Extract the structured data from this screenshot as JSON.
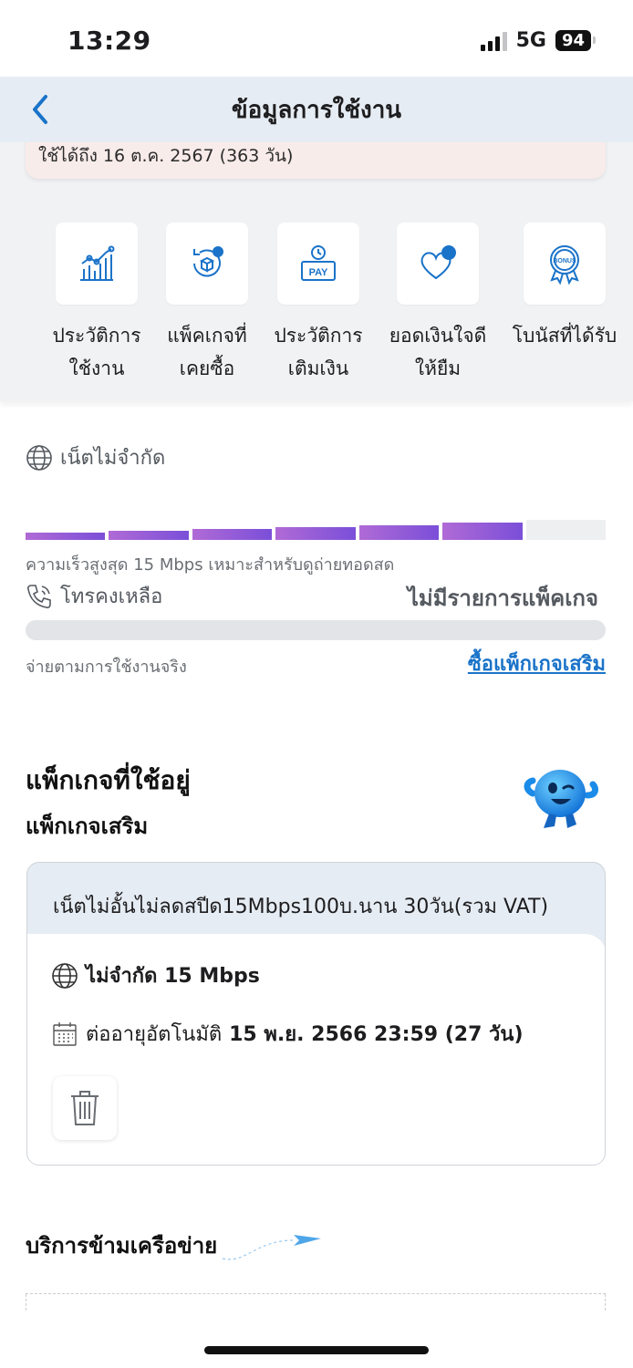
{
  "status_bar": {
    "time": "13:29",
    "network": "5G",
    "battery": "94"
  },
  "header": {
    "title": "ข้อมูลการใช้งาน"
  },
  "expiry": {
    "text": "ใช้ได้ถึง 16 ต.ค. 2567 (363 วัน)"
  },
  "quick_actions": [
    {
      "line1": "ประวัติการ",
      "line2": "ใช้งาน",
      "icon": "usage-chart-icon"
    },
    {
      "line1": "แพ็คเกจที่",
      "line2": "เคยซื้อ",
      "icon": "package-history-icon"
    },
    {
      "line1": "ประวัติการ",
      "line2": "เติมเงิน",
      "icon": "pay-history-icon"
    },
    {
      "line1": "ยอดเงินใจดี",
      "line2": "ให้ยืม",
      "icon": "heart-loan-icon"
    },
    {
      "line1": "โบนัสที่ได้รับ",
      "line2": "",
      "icon": "bonus-badge-icon"
    }
  ],
  "internet": {
    "label": "เน็ตไม่จำกัด",
    "description": "ความเร็วสูงสุด 15 Mbps เหมาะสำหรับดูถ่ายทอดสด",
    "filled_segments": 6,
    "total_segments": 7
  },
  "calls": {
    "label": "โทรคงเหลือ",
    "status": "ไม่มีรายการแพ็คเกจ",
    "description": "จ่ายตามการใช้งานจริง",
    "buy_link": "ซื้อแพ็กเกจเสริม"
  },
  "active_package": {
    "section_title": "แพ็กเกจที่ใช้อยู่",
    "sub_title": "แพ็กเกจเสริม",
    "name": "เน็ตไม่อั้นไม่ลดสปีด15Mbps100บ.นาน 30วัน(รวม VAT)",
    "speed": "ไม่จำกัด 15 Mbps",
    "renew_label": "ต่ออายุอัตโนมัติ",
    "renew_date": "15 พ.ย. 2566 23:59 (27 วัน)"
  },
  "roaming": {
    "title": "บริการข้ามเครือข่าย"
  },
  "colors": {
    "accent": "#1a73c9",
    "bar_start": "#b06ad6",
    "bar_end": "#7a4fd8",
    "header_bg": "#e6ecf3"
  }
}
